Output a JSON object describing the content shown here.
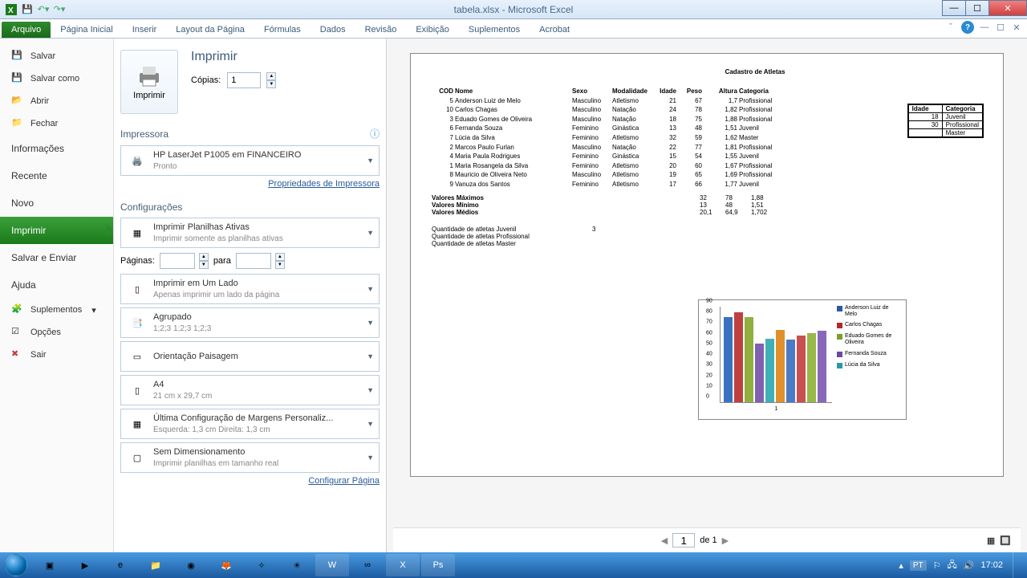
{
  "title": "tabela.xlsx - Microsoft Excel",
  "ribbon": {
    "file": "Arquivo",
    "tabs": [
      "Página Inicial",
      "Inserir",
      "Layout da Página",
      "Fórmulas",
      "Dados",
      "Revisão",
      "Exibição",
      "Suplementos",
      "Acrobat"
    ]
  },
  "sidebar": {
    "save": "Salvar",
    "saveas": "Salvar como",
    "open": "Abrir",
    "close": "Fechar",
    "info": "Informações",
    "recent": "Recente",
    "new": "Novo",
    "print": "Imprimir",
    "saveSend": "Salvar e Enviar",
    "help": "Ajuda",
    "addins": "Suplementos",
    "options": "Opções",
    "exit": "Sair"
  },
  "print": {
    "title": "Imprimir",
    "button": "Imprimir",
    "copiesLabel": "Cópias:",
    "copies": "1",
    "printerTitle": "Impressora",
    "printerName": "HP LaserJet P1005 em FINANCEIRO",
    "printerStatus": "Pronto",
    "printerProps": "Propriedades de Impressora",
    "settingsTitle": "Configurações",
    "what": {
      "t": "Imprimir Planilhas Ativas",
      "s": "Imprimir somente as planilhas ativas"
    },
    "pagesLabel": "Páginas:",
    "pagesTo": "para",
    "side": {
      "t": "Imprimir em Um Lado",
      "s": "Apenas imprimir um lado da página"
    },
    "collate": {
      "t": "Agrupado",
      "s": "1;2;3   1;2;3   1;2;3"
    },
    "orient": {
      "t": "Orientação Paisagem"
    },
    "paper": {
      "t": "A4",
      "s": "21 cm x 29,7 cm"
    },
    "margins": {
      "t": "Última Configuração de Margens Personaliz...",
      "s": "Esquerda: 1,3 cm   Direita: 1,3 cm"
    },
    "scale": {
      "t": "Sem Dimensionamento",
      "s": "Imprimir planilhas em tamanho real"
    },
    "pageSetup": "Configurar Página"
  },
  "preview": {
    "header": "Cadastro de Atletas",
    "cols": [
      "COD",
      "Nome",
      "Sexo",
      "Modalidade",
      "Idade",
      "Peso",
      "Altura",
      "Categoria"
    ],
    "rows": [
      [
        "5",
        "Anderson Luiz de Melo",
        "Masculino",
        "Atletismo",
        "21",
        "67",
        "1,7",
        "Profissional"
      ],
      [
        "10",
        "Carlos Chagas",
        "Masculino",
        "Natação",
        "24",
        "78",
        "1,82",
        "Profissional"
      ],
      [
        "3",
        "Eduado Gomes de Oliveira",
        "Masculino",
        "Natação",
        "18",
        "75",
        "1,88",
        "Profissional"
      ],
      [
        "6",
        "Fernanda Souza",
        "Feminino",
        "Ginástica",
        "13",
        "48",
        "1,51",
        "Juvenil"
      ],
      [
        "7",
        "Lúcia da Silva",
        "Feminino",
        "Atletismo",
        "32",
        "59",
        "1,62",
        "Master"
      ],
      [
        "2",
        "Marcos Paulo Furlan",
        "Masculino",
        "Natação",
        "22",
        "77",
        "1,81",
        "Profissional"
      ],
      [
        "4",
        "Maria Paula Rodrigues",
        "Feminino",
        "Ginástica",
        "15",
        "54",
        "1,55",
        "Juvenil"
      ],
      [
        "1",
        "Maria Rosangela da Silva",
        "Feminino",
        "Atletismo",
        "20",
        "60",
        "1,67",
        "Profissional"
      ],
      [
        "8",
        "Mauricio de Oliveira Neto",
        "Masculino",
        "Atletismo",
        "19",
        "65",
        "1,69",
        "Profissional"
      ],
      [
        "9",
        "Vanuza dos Santos",
        "Feminino",
        "Atletismo",
        "17",
        "66",
        "1,77",
        "Juvenil"
      ]
    ],
    "stats": [
      [
        "Valores Máximos",
        "32",
        "78",
        "1,88"
      ],
      [
        "Valores Mínimo",
        "13",
        "48",
        "1,51"
      ],
      [
        "Valores Médios",
        "20,1",
        "64,9",
        "1,702"
      ]
    ],
    "counts": [
      [
        "Quantidade de atletas Juvenil",
        "3"
      ],
      [
        "Quantidade de atletas Profissional",
        ""
      ],
      [
        "Quantidade de atletas Master",
        ""
      ]
    ],
    "sidetable": {
      "h": [
        "Idade",
        "Categoria"
      ],
      "r": [
        [
          "18",
          "Juvenil"
        ],
        [
          "30",
          "Profissional"
        ],
        [
          "",
          "Master"
        ]
      ]
    },
    "pageCur": "1",
    "pageOf": "de 1"
  },
  "chart_data": {
    "type": "bar",
    "title": "",
    "categories": [
      "1"
    ],
    "ylim": [
      0,
      90
    ],
    "yticks": [
      0,
      10,
      20,
      30,
      40,
      50,
      60,
      70,
      80,
      90
    ],
    "series": [
      {
        "name": "Anderson Luiz de Melo",
        "values": [
          67,
          82
        ],
        "color": "#2a5aa0"
      },
      {
        "name": "Carlos Chagas",
        "values": [
          78,
          68
        ],
        "color": "#b02a2a"
      },
      {
        "name": "Eduado Gomes de Oliveira",
        "values": [
          75,
          55
        ],
        "color": "#7aa02a"
      },
      {
        "name": "Fernanda Souza",
        "values": [
          48,
          62
        ],
        "color": "#6a4a9a"
      },
      {
        "name": "Lúcia da Silva",
        "values": [
          59,
          65
        ],
        "color": "#2a9aa0"
      }
    ],
    "colors3d": [
      "#3a70c0",
      "#c04040",
      "#90b040",
      "#8060b0",
      "#40b0b8",
      "#e0902a",
      "#4a7ac8",
      "#c85050",
      "#98b848",
      "#8868b8"
    ],
    "flatbars": [
      80,
      85,
      80,
      55,
      60,
      68,
      59,
      63,
      65,
      67
    ]
  },
  "taskbar": {
    "lang": "PT",
    "time": "17:02"
  }
}
